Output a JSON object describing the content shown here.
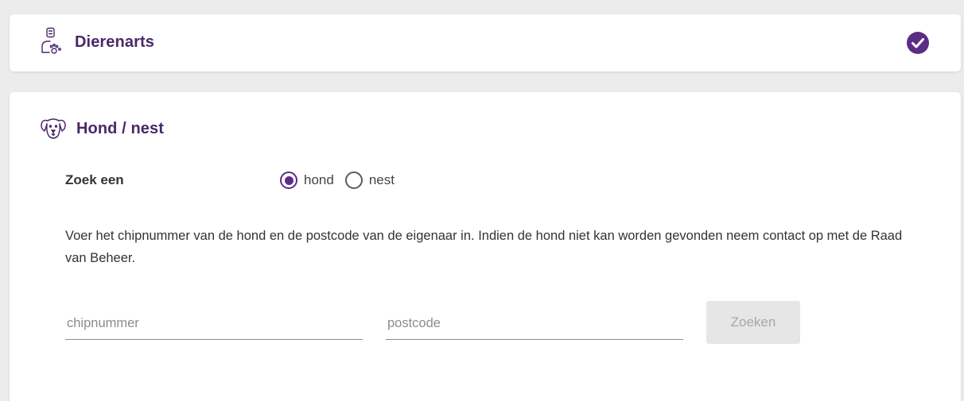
{
  "vet_section": {
    "title": "Dierenarts",
    "icon": "veterinarian-icon",
    "status_icon": "check-circle-icon",
    "status_color": "#5b2d84"
  },
  "dog_section": {
    "title": "Hond / nest",
    "icon": "dog-icon",
    "search_type": {
      "label": "Zoek een",
      "options": [
        {
          "label": "hond",
          "checked": true
        },
        {
          "label": "nest",
          "checked": false
        }
      ]
    },
    "description": "Voer het chipnummer van de hond en de postcode van de eigenaar in. Indien de hond niet kan worden gevonden neem contact op met de Raad van Beheer.",
    "chipnummer": {
      "value": "",
      "placeholder": "chipnummer"
    },
    "postcode": {
      "value": "",
      "placeholder": "postcode"
    },
    "search_button": "Zoeken"
  },
  "colors": {
    "accent": "#5b2d84",
    "title": "#4a2869",
    "background": "#ececec",
    "button_disabled_bg": "#e6e6e6",
    "button_disabled_text": "#a8a8a8"
  }
}
